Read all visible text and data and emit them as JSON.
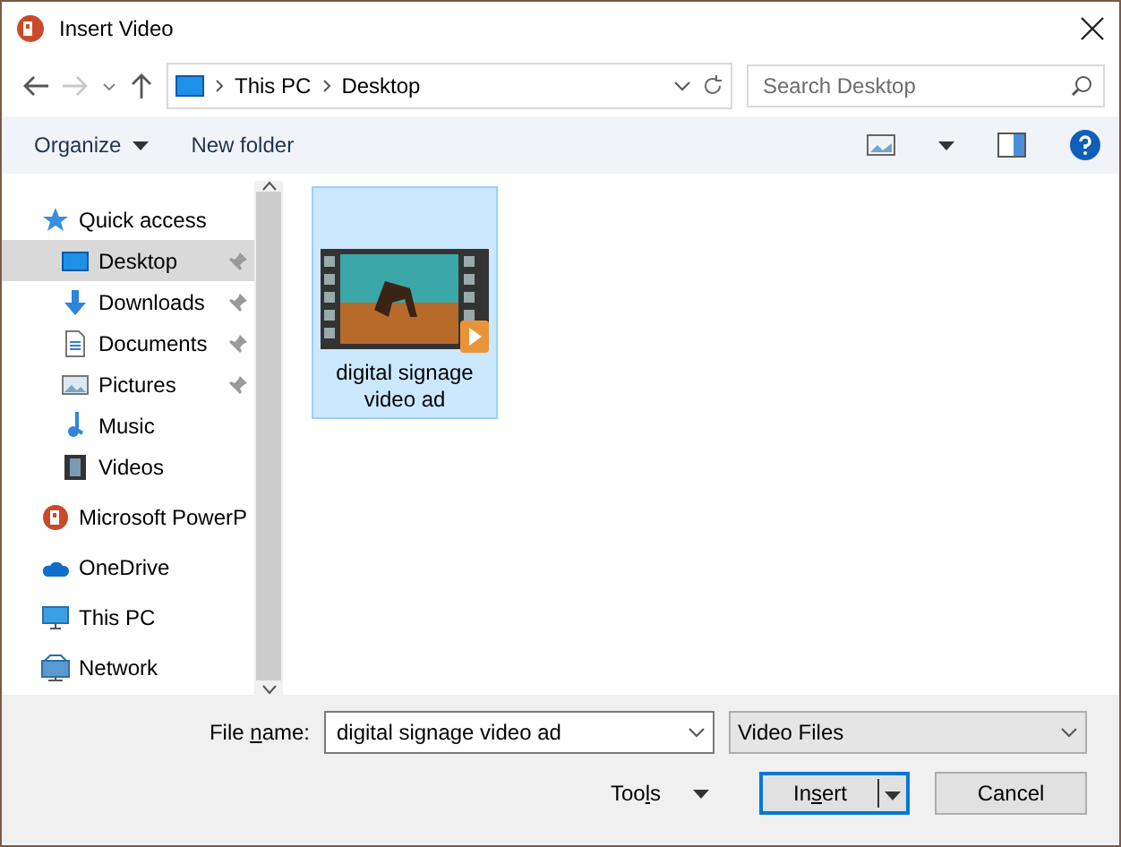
{
  "window": {
    "title": "Insert Video"
  },
  "address": {
    "path": [
      "This PC",
      "Desktop"
    ],
    "search_placeholder": "Search Desktop"
  },
  "toolbar": {
    "organize": "Organize",
    "new_folder": "New folder"
  },
  "sidebar": {
    "items": [
      {
        "label": "Quick access",
        "kind": "star",
        "selected": false,
        "pinned": false,
        "children": [
          {
            "label": "Desktop",
            "kind": "desktop",
            "selected": true,
            "pinned": true
          },
          {
            "label": "Downloads",
            "kind": "download",
            "selected": false,
            "pinned": true
          },
          {
            "label": "Documents",
            "kind": "document",
            "selected": false,
            "pinned": true
          },
          {
            "label": "Pictures",
            "kind": "picture",
            "selected": false,
            "pinned": true
          },
          {
            "label": "Music",
            "kind": "music",
            "selected": false,
            "pinned": false
          },
          {
            "label": "Videos",
            "kind": "video",
            "selected": false,
            "pinned": false
          }
        ]
      },
      {
        "label": "Microsoft PowerP",
        "kind": "powerpoint",
        "selected": false,
        "pinned": false
      },
      {
        "label": "OneDrive",
        "kind": "cloud",
        "selected": false,
        "pinned": false
      },
      {
        "label": "This PC",
        "kind": "pc",
        "selected": false,
        "pinned": false
      },
      {
        "label": "Network",
        "kind": "network",
        "selected": false,
        "pinned": false
      }
    ]
  },
  "files": [
    {
      "name": "digital signage video ad",
      "selected": true
    }
  ],
  "footer": {
    "file_name_label": "File name:",
    "file_name": "digital signage video ad",
    "filter": "Video Files",
    "tools": "Tools",
    "insert": "Insert",
    "cancel": "Cancel"
  }
}
